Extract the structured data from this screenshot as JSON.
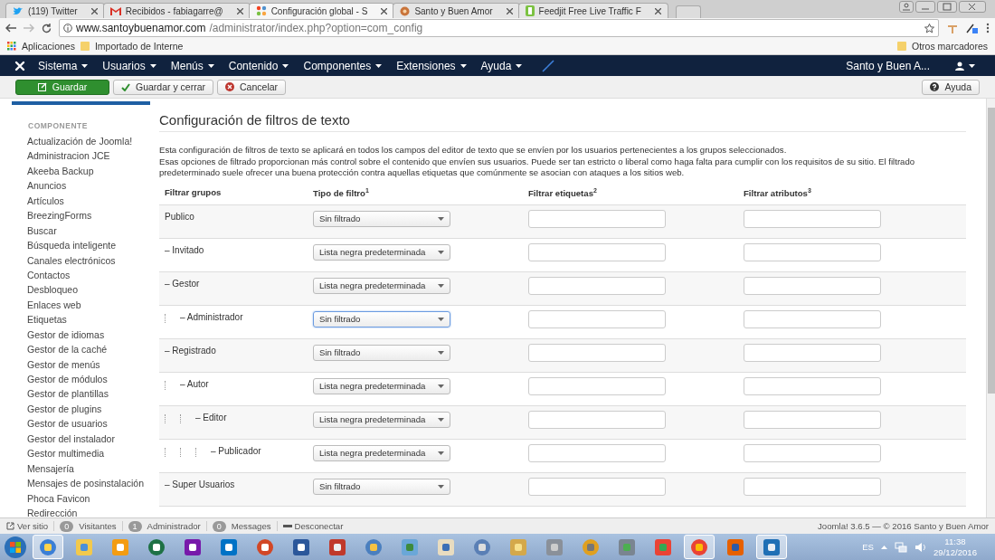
{
  "browser": {
    "tabs": [
      {
        "title": "(119) Twitter",
        "selected": false,
        "kind": "bird"
      },
      {
        "title": "Recibidos - fabiagarre@",
        "selected": false,
        "kind": "mail"
      },
      {
        "title": "Configuración global - S",
        "selected": true,
        "kind": "joomla"
      },
      {
        "title": "Santo y Buen Amor",
        "selected": false,
        "kind": "site"
      },
      {
        "title": "Feedjit Free Live Traffic F",
        "selected": false,
        "kind": "feed"
      }
    ],
    "url_host": "www.santoybuenamor.com",
    "url_path": "/administrator/index.php?option=com_config",
    "bookmarks": [
      "Aplicaciones",
      "Importado de Interne"
    ],
    "other_bookmarks": "Otros marcadores"
  },
  "nav": {
    "menus": [
      "Sistema",
      "Usuarios",
      "Menús",
      "Contenido",
      "Componentes",
      "Extensiones",
      "Ayuda"
    ],
    "site_name": "Santo y Buen A..."
  },
  "toolbar": {
    "buttons": [
      {
        "label": "Guardar",
        "kind": "save"
      },
      {
        "label": "Guardar y cerrar",
        "kind": "save-close"
      },
      {
        "label": "Cancelar",
        "kind": "cancel"
      }
    ],
    "help": "Ayuda"
  },
  "sidebar": {
    "heading": "COMPONENTE",
    "items": [
      "Actualización de Joomla!",
      "Administracion JCE",
      "Akeeba Backup",
      "Anuncios",
      "Artículos",
      "BreezingForms",
      "Buscar",
      "Búsqueda inteligente",
      "Canales electrónicos",
      "Contactos",
      "Desbloqueo",
      "Enlaces web",
      "Etiquetas",
      "Gestor de idiomas",
      "Gestor de la caché",
      "Gestor de menús",
      "Gestor de módulos",
      "Gestor de plantillas",
      "Gestor de plugins",
      "Gestor de usuarios",
      "Gestor del instalador",
      "Gestor multimedia",
      "Mensajería",
      "Mensajes de posinstalación",
      "Phoca Favicon",
      "Redirección"
    ]
  },
  "content": {
    "title": "Configuración de filtros de texto",
    "description": [
      "Esta configuración de filtros de texto se aplicará en todos los campos del editor de texto que se envíen por los usuarios pertenecientes a los grupos seleccionados.",
      "Esas opciones de filtrado proporcionan más control sobre el contenido que envíen sus usuarios. Puede ser tan estricto o liberal como haga falta para cumplir con los requisitos de su sitio. El filtrado predeterminado suele ofrecer una buena protección contra aquellas etiquetas que comúnmente se asocian con ataques a los sitios web."
    ],
    "columns": [
      "Filtrar grupos",
      "Tipo de filtro$^{1}$",
      "Filtrar etiquetas$^{2}$",
      "Filtrar atributos$^{3}$"
    ],
    "groups": [
      {
        "label": "Publico",
        "filter": "Sin filtrado",
        "focused": false,
        "children": [
          {
            "label": "– Invitado",
            "filter": "Lista negra predeterminada",
            "focused": false
          },
          {
            "label": "– Gestor",
            "filter": "Lista negra predeterminada",
            "focused": false,
            "children": [
              {
                "label": "– Administrador",
                "filter": "Sin filtrado",
                "focused": true
              }
            ]
          },
          {
            "label": "– Registrado",
            "filter": "Sin filtrado",
            "focused": false,
            "children": [
              {
                "label": "– Autor",
                "filter": "Lista negra predeterminada",
                "focused": false,
                "children": [
                  {
                    "label": "– Editor",
                    "filter": "Lista negra predeterminada",
                    "focused": false,
                    "children": [
                      {
                        "label": "– Publicador",
                        "filter": "Lista negra predeterminada",
                        "focused": false
                      }
                    ]
                  }
                ]
              }
            ]
          },
          {
            "label": "– Super Usuarios",
            "filter": "Sin filtrado",
            "focused": false
          }
        ]
      }
    ]
  },
  "status_bar": {
    "view_site": "Ver sitio",
    "counters": [
      {
        "count": "0",
        "label": "Visitantes"
      },
      {
        "count": "1",
        "label": "Administrador"
      },
      {
        "count": "0",
        "label": "Messages"
      }
    ],
    "logout": "Desconectar",
    "footer": "Joomla! 3.6.5 — © 2016 Santo y Buen Amor"
  },
  "taskbar": {
    "apps": [
      {
        "active": true
      },
      {
        "active": false
      },
      {
        "active": false
      },
      {
        "active": false
      },
      {
        "active": false
      },
      {
        "active": false
      },
      {
        "active": false
      },
      {
        "active": false
      },
      {
        "active": false
      },
      {
        "active": false
      },
      {
        "active": false
      },
      {
        "active": false
      },
      {
        "active": false
      },
      {
        "active": false
      },
      {
        "active": false
      },
      {
        "active": false
      },
      {
        "active": false
      },
      {
        "active": false
      },
      {
        "active": true
      },
      {
        "active": false
      },
      {
        "active": true
      }
    ],
    "language": "ES",
    "time": "11:38",
    "date": "29/12/2016"
  }
}
